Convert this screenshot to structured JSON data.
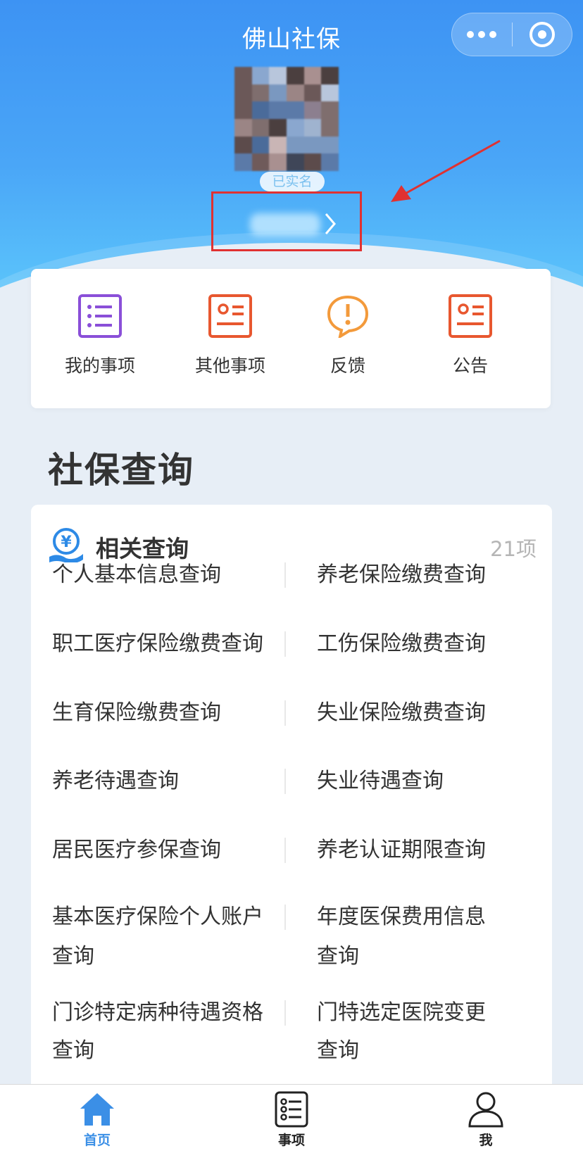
{
  "nav": {
    "title": "佛山社保",
    "more_icon": "more-dots-icon",
    "close_icon": "target-circle-icon"
  },
  "profile": {
    "verified_label": "已实名",
    "name_masked": "",
    "chevron_icon": "chevron-right-icon"
  },
  "quick_actions": [
    {
      "label": "我的事项",
      "icon": "list-icon",
      "color": "#8a4fd8"
    },
    {
      "label": "其他事项",
      "icon": "id-card-icon",
      "color": "#e8572f"
    },
    {
      "label": "反馈",
      "icon": "exclamation-bubble-icon",
      "color": "#f39a3b"
    },
    {
      "label": "公告",
      "icon": "id-card-icon",
      "color": "#e8572f"
    }
  ],
  "section_title": "社保查询",
  "query_card": {
    "title": "相关查询",
    "count": "21项",
    "icon": "yen-hand-icon",
    "items": [
      "个人基本信息查询",
      "养老保险缴费查询",
      "职工医疗保险缴费查询",
      "工伤保险缴费查询",
      "生育保险缴费查询",
      "失业保险缴费查询",
      "养老待遇查询",
      "失业待遇查询",
      "居民医疗参保查询",
      "养老认证期限查询",
      "基本医疗保险个人账户",
      "查询",
      "年度医保费用信息",
      "查询",
      "门诊特定病种待遇资格",
      "查询",
      "门特选定医院变更",
      "查询"
    ]
  },
  "tabbar": [
    {
      "label": "首页",
      "icon": "home-icon",
      "active": true
    },
    {
      "label": "事项",
      "icon": "checklist-icon",
      "active": false
    },
    {
      "label": "我",
      "icon": "person-icon",
      "active": false
    }
  ],
  "colors": {
    "primary": "#3d93f3",
    "highlight_box": "#e03131",
    "tab_active": "#3b8fe6"
  }
}
